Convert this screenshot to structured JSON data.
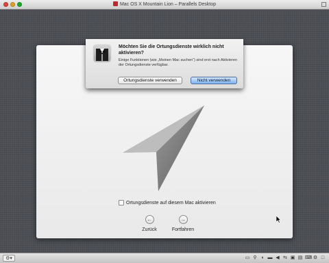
{
  "host": {
    "title": "Mac OS X Mountain Lion – Parallels Desktop",
    "status_menu": "⚙▾",
    "status_icons": [
      {
        "name": "monitor-icon",
        "glyph": "▭"
      },
      {
        "name": "usb-icon",
        "glyph": "⚲"
      },
      {
        "name": "microphone-icon",
        "glyph": "◗"
      },
      {
        "name": "hard-disk-icon",
        "glyph": "▬"
      },
      {
        "name": "speaker-icon",
        "glyph": "◀"
      },
      {
        "name": "network-icon",
        "glyph": "⇆"
      },
      {
        "name": "shared-folder-icon",
        "glyph": "▣"
      },
      {
        "name": "printer-icon",
        "glyph": "▤"
      },
      {
        "name": "keyboard-icon",
        "glyph": "⌨"
      },
      {
        "name": "settings-icon",
        "glyph": "⚙"
      },
      {
        "name": "window-mode-icon",
        "glyph": "□"
      }
    ]
  },
  "setup": {
    "checkbox_label": "Ortungsdienste auf diesem Mac aktivieren",
    "checkbox_checked": false,
    "back_label": "Zurück",
    "next_label": "Fortfahren"
  },
  "dialog": {
    "title": "Möchten Sie die Ortungsdienste wirklich nicht aktivieren?",
    "body": "Einige Funktionen (wie „Meinen Mac suchen“) sind erst nach Aktivieren der Ortungsdienste verfügbar.",
    "enable_button": "Ortungsdienste verwenden",
    "disable_button": "Nicht verwenden",
    "default_button_color": "#7fb1ef"
  }
}
